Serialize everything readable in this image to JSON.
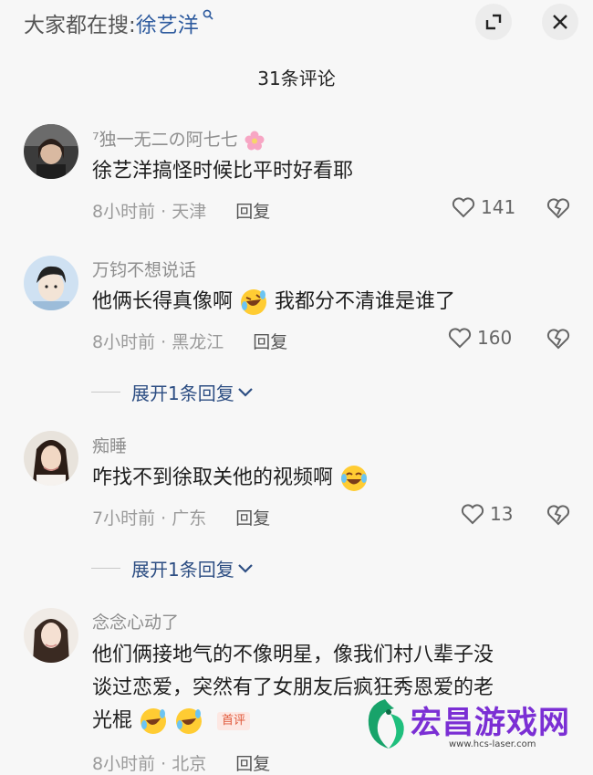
{
  "header": {
    "search_prefix": "大家都在搜:",
    "search_keyword": "徐艺洋",
    "title": "31条评论"
  },
  "comments": [
    {
      "username": "⁷独一无二の阿七七",
      "text": "徐艺洋搞怪时候比平时好看耶",
      "time_location": "8小时前 · 天津",
      "reply_label": "回复",
      "likes": "141"
    },
    {
      "username": "万钧不想说话",
      "text_a": "他俩长得真像啊",
      "text_b": "我都分不清谁是谁了",
      "time_location": "8小时前 · 黑龙江",
      "reply_label": "回复",
      "likes": "160",
      "expand_label": "展开1条回复"
    },
    {
      "username": "痴睡",
      "text": "咋找不到徐取关他的视频啊",
      "time_location": "7小时前 · 广东",
      "reply_label": "回复",
      "likes": "13",
      "expand_label": "展开1条回复"
    },
    {
      "username": "念念心动了",
      "text_line1": "他们俩接地气的不像明星，像我们村八辈子没",
      "text_line2": "谈过恋爱，突然有了女朋友后疯狂秀恩爱的老",
      "text_line3": "光棍",
      "badge": "首评",
      "time_location": "8小时前 · 北京",
      "reply_label": "回复"
    }
  ],
  "watermark": {
    "brand": "宏昌游戏网",
    "url": "www.hcs-laser.com"
  },
  "colors": {
    "keyword_blue": "#2d5a9e",
    "expand_blue": "#2d4e83",
    "badge_red": "#e0593a",
    "watermark_purple": "#7b2fd4"
  }
}
